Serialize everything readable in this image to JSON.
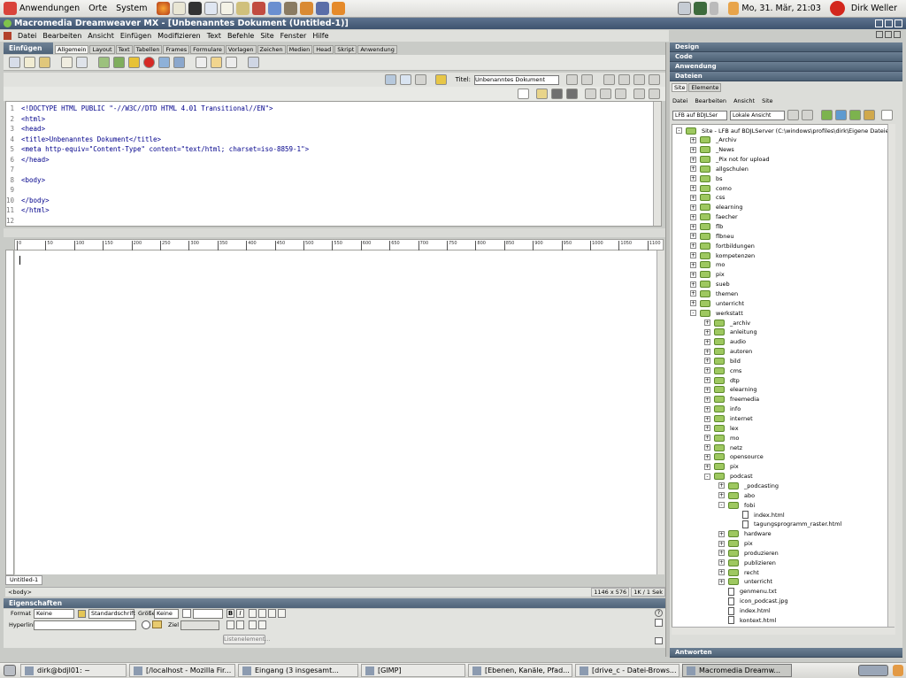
{
  "gnome_panel": {
    "menus": [
      "Anwendungen",
      "Orte",
      "System"
    ],
    "clock": "Mo, 31. Mär, 21:03",
    "user": "Dirk Weller"
  },
  "window": {
    "title": "Macromedia Dreamweaver MX - [Unbenanntes Dokument (Untitled-1)]"
  },
  "menubar": [
    "Datei",
    "Bearbeiten",
    "Ansicht",
    "Einfügen",
    "Modifizieren",
    "Text",
    "Befehle",
    "Site",
    "Fenster",
    "Hilfe"
  ],
  "insert_panel": {
    "title": "Einfügen",
    "tabs": [
      "Allgemein",
      "Layout",
      "Text",
      "Tabellen",
      "Frames",
      "Formulare",
      "Vorlagen",
      "Zeichen",
      "Medien",
      "Head",
      "Skript",
      "Anwendung"
    ],
    "active_tab": "Allgemein"
  },
  "doc_toolbar": {
    "title_label": "Titel:",
    "title_value": "Unbenanntes Dokument"
  },
  "code": {
    "lines": [
      {
        "n": "1",
        "text": "<!DOCTYPE HTML PUBLIC \"-//W3C//DTD HTML 4.01 Transitional//EN\">"
      },
      {
        "n": "2",
        "text": "<html>"
      },
      {
        "n": "3",
        "text": "<head>"
      },
      {
        "n": "4",
        "text": "<title>Unbenanntes Dokument</title>"
      },
      {
        "n": "5",
        "text": "<meta http-equiv=\"Content-Type\" content=\"text/html; charset=iso-8859-1\">"
      },
      {
        "n": "6",
        "text": "</head>"
      },
      {
        "n": "7",
        "text": ""
      },
      {
        "n": "8",
        "text": "<body>"
      },
      {
        "n": "9",
        "text": ""
      },
      {
        "n": "10",
        "text": "</body>"
      },
      {
        "n": "11",
        "text": "</html>"
      },
      {
        "n": "12",
        "text": ""
      }
    ]
  },
  "ruler": {
    "ticks": [
      "0",
      "50",
      "100",
      "150",
      "200",
      "250",
      "300",
      "350",
      "400",
      "450",
      "500",
      "550",
      "600",
      "650",
      "700",
      "750",
      "800",
      "850",
      "900",
      "950",
      "1000",
      "1050",
      "1100"
    ]
  },
  "document_tab": "Untitled-1",
  "statusbar": {
    "tag": "<body>",
    "size": "1146 x 576",
    "download": "1K / 1 Sek"
  },
  "properties": {
    "title": "Eigenschaften",
    "format_label": "Format",
    "format_value": "Keine",
    "font_value": "Standardschrift",
    "size_label": "Größe",
    "size_value": "Keine",
    "link_label": "Hyperlink",
    "target_label": "Ziel",
    "list_button": "Listenelement..."
  },
  "right_panel": {
    "sections": [
      "Design",
      "Code",
      "Anwendung"
    ],
    "files_title": "Dateien",
    "files_tabs": [
      "Site",
      "Elemente"
    ],
    "files_menu": [
      "Datei",
      "Bearbeiten",
      "Ansicht",
      "Site"
    ],
    "site_select": "LFB auf BDJLSer",
    "view_select": "Lokale Ansicht",
    "bottom_section": "Antworten"
  },
  "tree": [
    {
      "label": "Site - LFB auf BDJLServer (C:\\windows\\profiles\\dirk\\Eigene Dateien\\Serverve",
      "level": 0,
      "type": "site",
      "exp": "-"
    },
    {
      "label": "_Archiv",
      "level": 1,
      "type": "folder",
      "exp": "+"
    },
    {
      "label": "_News",
      "level": 1,
      "type": "folder",
      "exp": "+"
    },
    {
      "label": "_Pix not for upload",
      "level": 1,
      "type": "folder",
      "exp": "+"
    },
    {
      "label": "allgschulen",
      "level": 1,
      "type": "folder",
      "exp": "+"
    },
    {
      "label": "bs",
      "level": 1,
      "type": "folder",
      "exp": "+"
    },
    {
      "label": "como",
      "level": 1,
      "type": "folder",
      "exp": "+"
    },
    {
      "label": "css",
      "level": 1,
      "type": "folder",
      "exp": "+"
    },
    {
      "label": "elearning",
      "level": 1,
      "type": "folder",
      "exp": "+"
    },
    {
      "label": "faecher",
      "level": 1,
      "type": "folder",
      "exp": "+"
    },
    {
      "label": "flb",
      "level": 1,
      "type": "folder",
      "exp": "+"
    },
    {
      "label": "flbneu",
      "level": 1,
      "type": "folder",
      "exp": "+"
    },
    {
      "label": "fortbildungen",
      "level": 1,
      "type": "folder",
      "exp": "+"
    },
    {
      "label": "kompetenzen",
      "level": 1,
      "type": "folder",
      "exp": "+"
    },
    {
      "label": "mo",
      "level": 1,
      "type": "folder",
      "exp": "+"
    },
    {
      "label": "pix",
      "level": 1,
      "type": "folder",
      "exp": "+"
    },
    {
      "label": "sueb",
      "level": 1,
      "type": "folder",
      "exp": "+"
    },
    {
      "label": "themen",
      "level": 1,
      "type": "folder",
      "exp": "+"
    },
    {
      "label": "unterricht",
      "level": 1,
      "type": "folder",
      "exp": "+"
    },
    {
      "label": "werkstatt",
      "level": 1,
      "type": "folder",
      "exp": "-"
    },
    {
      "label": "_archiv",
      "level": 2,
      "type": "folder",
      "exp": "+"
    },
    {
      "label": "anleitung",
      "level": 2,
      "type": "folder",
      "exp": "+"
    },
    {
      "label": "audio",
      "level": 2,
      "type": "folder",
      "exp": "+"
    },
    {
      "label": "autoren",
      "level": 2,
      "type": "folder",
      "exp": "+"
    },
    {
      "label": "bild",
      "level": 2,
      "type": "folder",
      "exp": "+"
    },
    {
      "label": "cms",
      "level": 2,
      "type": "folder",
      "exp": "+"
    },
    {
      "label": "dtp",
      "level": 2,
      "type": "folder",
      "exp": "+"
    },
    {
      "label": "elearning",
      "level": 2,
      "type": "folder",
      "exp": "+"
    },
    {
      "label": "freemedia",
      "level": 2,
      "type": "folder",
      "exp": "+"
    },
    {
      "label": "info",
      "level": 2,
      "type": "folder",
      "exp": "+"
    },
    {
      "label": "internet",
      "level": 2,
      "type": "folder",
      "exp": "+"
    },
    {
      "label": "lex",
      "level": 2,
      "type": "folder",
      "exp": "+"
    },
    {
      "label": "mo",
      "level": 2,
      "type": "folder",
      "exp": "+"
    },
    {
      "label": "netz",
      "level": 2,
      "type": "folder",
      "exp": "+"
    },
    {
      "label": "opensource",
      "level": 2,
      "type": "folder",
      "exp": "+"
    },
    {
      "label": "pix",
      "level": 2,
      "type": "folder",
      "exp": "+"
    },
    {
      "label": "podcast",
      "level": 2,
      "type": "folder",
      "exp": "-"
    },
    {
      "label": "_podcasting",
      "level": 3,
      "type": "folder",
      "exp": "+"
    },
    {
      "label": "abo",
      "level": 3,
      "type": "folder",
      "exp": "+"
    },
    {
      "label": "fobi",
      "level": 3,
      "type": "folder",
      "exp": "-"
    },
    {
      "label": "index.html",
      "level": 4,
      "type": "file",
      "exp": ""
    },
    {
      "label": "tagungsprogramm_raster.html",
      "level": 4,
      "type": "file",
      "exp": ""
    },
    {
      "label": "hardware",
      "level": 3,
      "type": "folder",
      "exp": "+"
    },
    {
      "label": "pix",
      "level": 3,
      "type": "folder",
      "exp": "+"
    },
    {
      "label": "produzieren",
      "level": 3,
      "type": "folder",
      "exp": "+"
    },
    {
      "label": "publizieren",
      "level": 3,
      "type": "folder",
      "exp": "+"
    },
    {
      "label": "recht",
      "level": 3,
      "type": "folder",
      "exp": "+"
    },
    {
      "label": "unterricht",
      "level": 3,
      "type": "folder",
      "exp": "+"
    },
    {
      "label": "genmenu.txt",
      "level": 3,
      "type": "file",
      "exp": ""
    },
    {
      "label": "icon_podcast.jpg",
      "level": 3,
      "type": "file",
      "exp": ""
    },
    {
      "label": "index.html",
      "level": 3,
      "type": "file",
      "exp": ""
    },
    {
      "label": "kontext.html",
      "level": 3,
      "type": "file",
      "exp": ""
    }
  ],
  "taskbar": [
    {
      "label": "dirk@bdjl01: ~",
      "active": false
    },
    {
      "label": "[/localhost - Mozilla Fir...",
      "active": false
    },
    {
      "label": "Eingang (3 insgesamt...",
      "active": false
    },
    {
      "label": "[GIMP]",
      "active": false
    },
    {
      "label": "[Ebenen, Kanäle, Pfad...",
      "active": false
    },
    {
      "label": "[drive_c - Datei-Brows...",
      "active": false
    },
    {
      "label": "Macromedia Dreamw...",
      "active": true
    }
  ],
  "colors": {
    "titlebar": "#4a607b",
    "panel_header": "#5a6e84",
    "folder": "#9ec860",
    "code_tag": "#00008b"
  }
}
